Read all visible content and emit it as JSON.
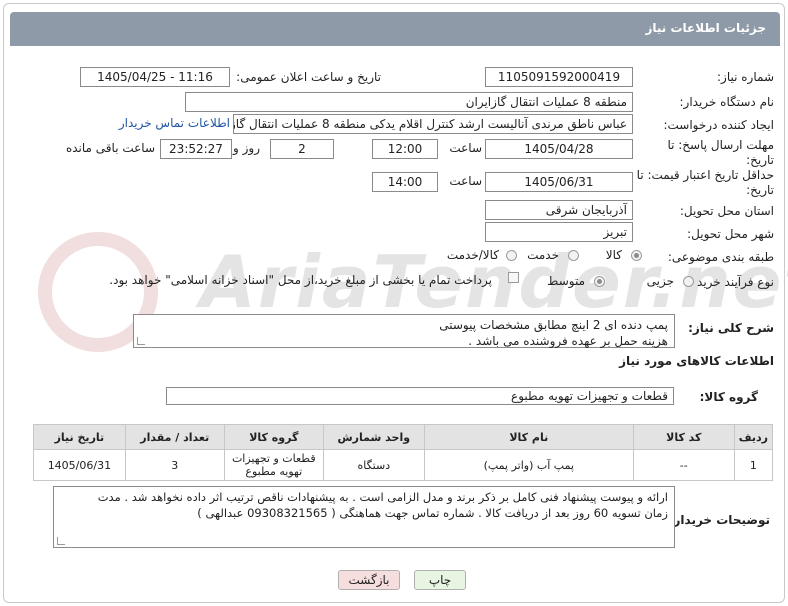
{
  "header": {
    "title": "جزئیات اطلاعات نیاز"
  },
  "fields": {
    "need_number_label": "شماره نیاز:",
    "need_number": "1105091592000419",
    "announce_label": "تاریخ و ساعت اعلان عمومی:",
    "announce_value": "1405/04/25 - 11:16",
    "buyer_org_label": "نام دستگاه خریدار:",
    "buyer_org": "منطقه 8 عملیات انتقال گازایران",
    "creator_label": "ایجاد کننده درخواست:",
    "creator": "عباس ناطق مرندی آنالیست ارشد کنترل اقلام یدکی منطقه 8 عملیات انتقال گاز",
    "contact_link": "اطلاعات تماس خریدار",
    "reply_deadline_label": "مهلت ارسال پاسخ: تا تاریخ:",
    "reply_date": "1405/04/28",
    "time_label": "ساعت",
    "reply_time": "12:00",
    "days_value": "2",
    "days_label": "روز و",
    "remaining_value": "23:52:27",
    "remaining_label": "ساعت باقی مانده",
    "price_validity_label": "حداقل تاریخ اعتبار قیمت: تا تاریخ:",
    "price_date": "1405/06/31",
    "price_time": "14:00",
    "province_label": "استان محل تحویل:",
    "province": "آذربایجان شرقی",
    "city_label": "شهر محل تحویل:",
    "city": "تبریز",
    "category_label": "طبقه بندی موضوعی:",
    "category_options": [
      "کالا",
      "خدمت",
      "کالا/خدمت"
    ],
    "process_label": "نوع فرآیند خرید :",
    "process_options": [
      "جزیی",
      "متوسط"
    ],
    "payment_note": "پرداخت تمام یا بخشی از مبلغ خرید،از محل \"اسناد خزانه اسلامی\" خواهد بود.",
    "description_label": "شرح کلی نیاز:",
    "description_line1": "پمپ دنده ای 2 اینچ مطابق مشخصات پیوستی",
    "description_line2": "هزینه حمل بر عهده فروشنده می باشد ."
  },
  "goods": {
    "section_title": "اطلاعات کالاهای مورد نیاز",
    "group_label": "گروه کالا:",
    "group_value": "قطعات و تجهیزات تهویه مطبوع",
    "columns": [
      "ردیف",
      "کد کالا",
      "نام کالا",
      "واحد شمارش",
      "گروه کالا",
      "تعداد / مقدار",
      "تاریخ نیاز"
    ],
    "rows": [
      {
        "row": "1",
        "code": "--",
        "name": "پمپ آب (واتر پمپ)",
        "unit": "دستگاه",
        "group": "قطعات و تجهیزات تهویه مطبوع",
        "qty": "3",
        "date": "1405/06/31"
      }
    ]
  },
  "notes": {
    "label": "توضیحات خریدار:",
    "line1": "ارائه و پیوست پیشنهاد فنی کامل بر ذکر  برند و مدل الزامی است . به پیشنهادات ناقص ترتیب اثر داده نخواهد شد . مدت",
    "line2": "زمان تسویه 60 روز بعد از دریافت کالا . شماره تماس جهت هماهنگی ( 09308321565 عبدالهی )"
  },
  "buttons": {
    "print": "چاپ",
    "back": "بازگشت"
  },
  "watermark": "AriaTender.net",
  "colors": {
    "titlebar": "#8e9aa7",
    "back_button_bg": "#f7dede",
    "print_button_bg": "#e8f5e2",
    "link": "#2055a4"
  }
}
